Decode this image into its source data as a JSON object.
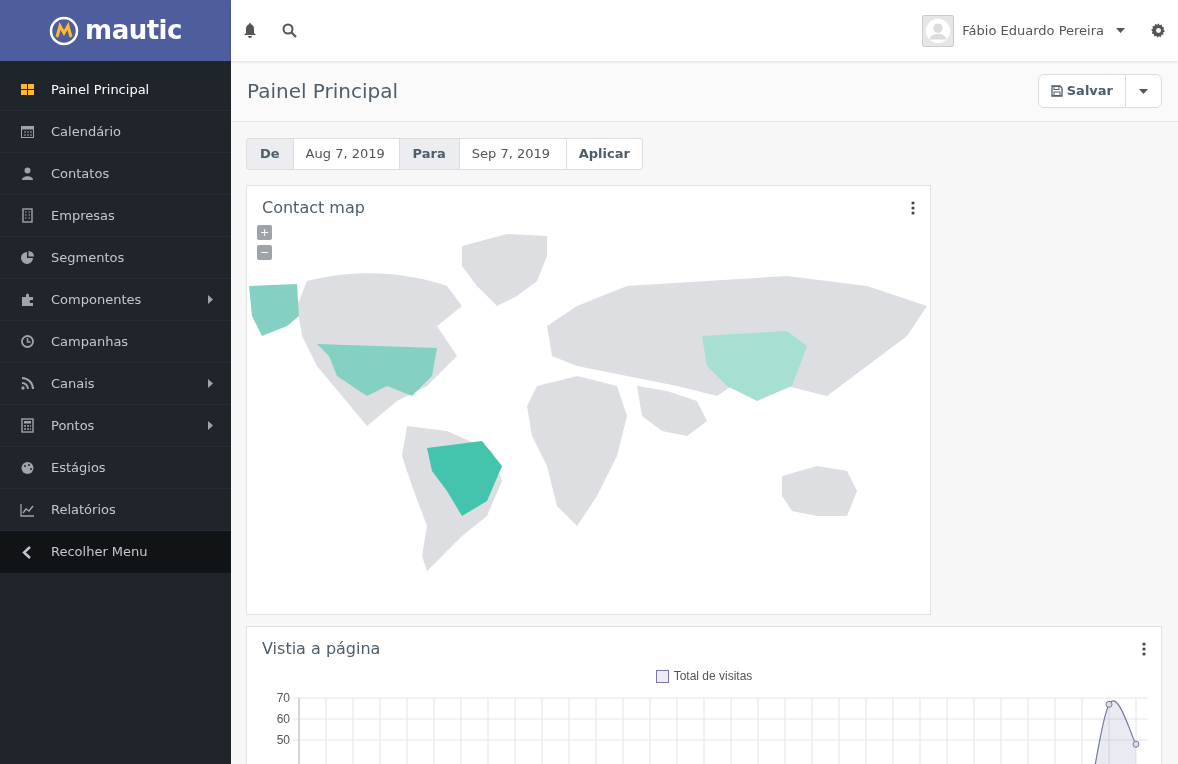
{
  "brand": {
    "name": "mautic"
  },
  "topbar": {
    "user": "Fábio Eduardo Pereira"
  },
  "sidebar": {
    "items": [
      {
        "label": "Painel Principal",
        "selected": true,
        "submenu": false
      },
      {
        "label": "Calendário",
        "selected": false,
        "submenu": false
      },
      {
        "label": "Contatos",
        "selected": false,
        "submenu": false
      },
      {
        "label": "Empresas",
        "selected": false,
        "submenu": false
      },
      {
        "label": "Segmentos",
        "selected": false,
        "submenu": false
      },
      {
        "label": "Componentes",
        "selected": false,
        "submenu": true
      },
      {
        "label": "Campanhas",
        "selected": false,
        "submenu": false
      },
      {
        "label": "Canais",
        "selected": false,
        "submenu": true
      },
      {
        "label": "Pontos",
        "selected": false,
        "submenu": true
      },
      {
        "label": "Estágios",
        "selected": false,
        "submenu": false
      },
      {
        "label": "Relatórios",
        "selected": false,
        "submenu": false
      }
    ],
    "collapse": "Recolher Menu"
  },
  "page": {
    "title": "Painel Principal",
    "save": "Salvar"
  },
  "date_range": {
    "from_label": "De",
    "from": "Aug 7, 2019",
    "to_label": "Para",
    "to": "Sep 7, 2019",
    "apply": "Aplicar"
  },
  "map_widget": {
    "title": "Contact map",
    "zoom_in": "+",
    "zoom_out": "−"
  },
  "visits_widget": {
    "title": "Vistia a página",
    "chart_data": {
      "type": "area",
      "ylim": [
        0,
        70
      ],
      "yticks": [
        50,
        60,
        70
      ],
      "grid": true,
      "series": [
        {
          "name": "Total de visitas",
          "color": "#7478a8",
          "values": [
            null,
            null,
            null,
            null,
            null,
            null,
            null,
            null,
            null,
            null,
            null,
            null,
            null,
            null,
            null,
            null,
            null,
            null,
            null,
            null,
            null,
            null,
            null,
            null,
            null,
            null,
            null,
            null,
            null,
            0,
            67,
            48
          ]
        }
      ]
    }
  }
}
